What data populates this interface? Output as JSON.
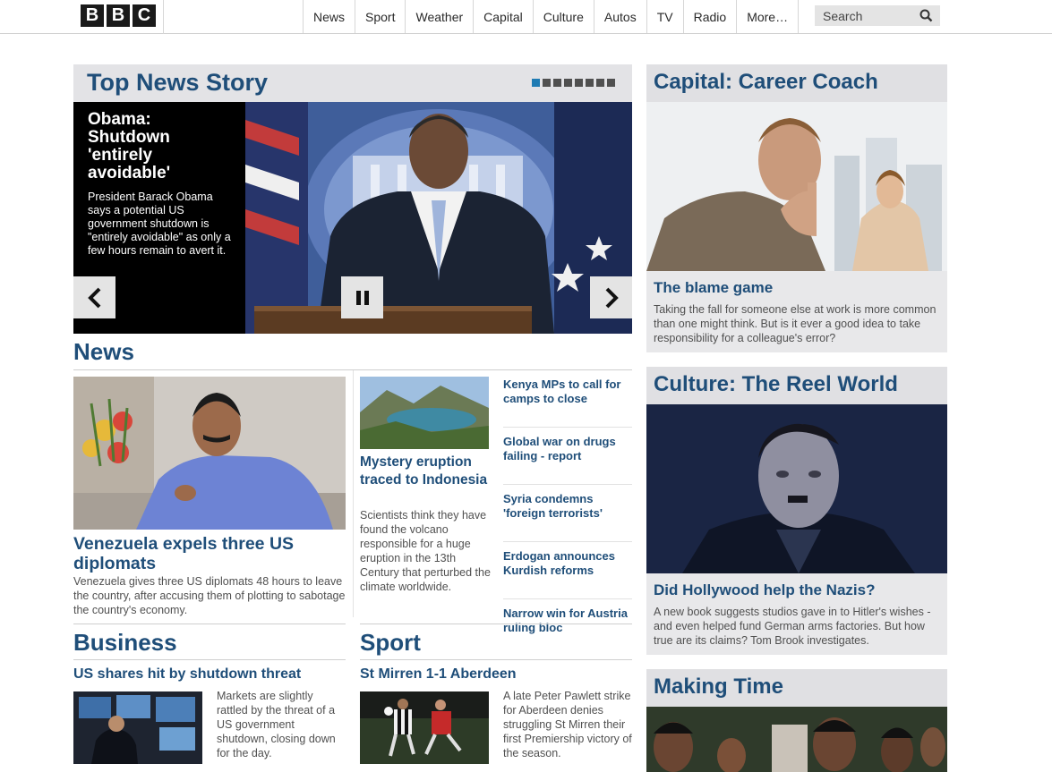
{
  "header": {
    "logo_letters": [
      "B",
      "B",
      "C"
    ],
    "nav": [
      "News",
      "Sport",
      "Weather",
      "Capital",
      "Culture",
      "Autos",
      "TV",
      "Radio",
      "More…"
    ],
    "search_placeholder": "Search"
  },
  "top_story": {
    "section_title": "Top News Story",
    "headline": "Obama: Shutdown 'entirely avoidable'",
    "summary": "President Barack Obama says a potential US government shutdown is \"entirely avoidable\" as only a few hours remain to avert it.",
    "carousel_pages": 8,
    "active_page": 1
  },
  "news": {
    "section_title": "News",
    "main": {
      "title": "Venezuela expels three US diplomats",
      "summary": "Venezuela gives three US diplomats 48 hours to leave the country, after accusing them of plotting to sabotage the country's economy."
    },
    "secondary": {
      "title": "Mystery eruption traced to Indonesia",
      "summary": "Scientists think they have found the volcano responsible for a huge eruption in the 13th Century that perturbed the climate worldwide."
    },
    "headlines": [
      "Kenya MPs to call for camps to close",
      "Global war on drugs failing - report",
      "Syria condemns 'foreign terrorists'",
      "Erdogan announces Kurdish reforms",
      "Narrow win for Austria ruling bloc"
    ]
  },
  "business": {
    "section_title": "Business",
    "headline": "US shares hit by shutdown threat",
    "summary": "Markets are slightly rattled by the threat of a US government shutdown, closing down for the day."
  },
  "sport": {
    "section_title": "Sport",
    "headline": "St Mirren 1-1 Aberdeen",
    "summary": "A late Peter Pawlett strike for Aberdeen denies struggling St Mirren their first Premiership victory of the season."
  },
  "capital": {
    "section_title": "Capital: Career Coach",
    "headline": "The blame game",
    "summary": "Taking the fall for someone else at work is more common than one might think. But is it ever a good idea to take responsibility for a colleague's error?"
  },
  "culture": {
    "section_title": "Culture: The Reel World",
    "headline": "Did Hollywood help the Nazis?",
    "summary": "A new book suggests studios gave in to Hitler's wishes - and even helped fund German arms factories. But how true are its claims? Tom Brook investigates."
  },
  "making_time": {
    "section_title": "Making Time"
  },
  "colors": {
    "heading_blue": "#1f4e79",
    "active_dot": "#1f7bb3",
    "panel_gray": "#e3e3e6"
  }
}
